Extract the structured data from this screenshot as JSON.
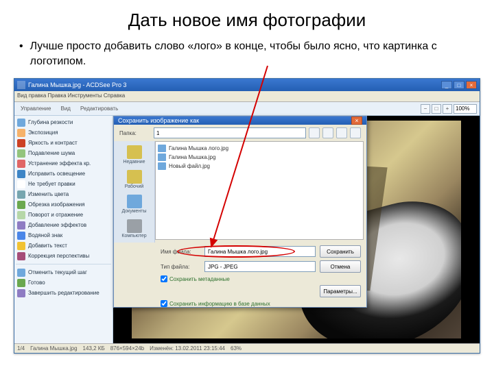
{
  "slide": {
    "title": "Дать новое имя фотографии",
    "bullet": "Лучше просто добавить слово «лого» в конце, чтобы было ясно, что картинка с логотипом."
  },
  "app": {
    "title": "Галина Мышка.jpg - ACDSee Pro 3",
    "menubar": "Вид правка Правка Инструменты Справка",
    "zoom_value": "100%",
    "toolbar": {
      "tab_browse": "Управление",
      "tab_view": "Вид",
      "tab_edit": "Редактировать"
    },
    "status": {
      "index": "1/4",
      "file": "Галина Мышка.jpg",
      "size": "143,2 КБ",
      "dims": "876×594×24b",
      "date": "Изменён: 13.02.2011 23:15:44",
      "pct": "63%"
    }
  },
  "sidebar": {
    "items": [
      {
        "label": "Глубина резкости",
        "color": "#6fa8dc"
      },
      {
        "label": "Экспозиция",
        "color": "#f6b26b"
      },
      {
        "label": "Яркость и контраст",
        "color": "#cc4125"
      },
      {
        "label": "Подавление шума",
        "color": "#93c47d"
      },
      {
        "label": "Устранение эффекта кр.",
        "color": "#e06666"
      },
      {
        "label": "Исправить освещение",
        "color": "#3d85c6"
      },
      {
        "label": "Не требует правки",
        "color": "#ffffff"
      },
      {
        "label": "Изменить цвета",
        "color": "#76a5af"
      },
      {
        "label": "Обрезка изображения",
        "color": "#6aa84f"
      },
      {
        "label": "Поворот и отражение",
        "color": "#b6d7a8"
      },
      {
        "label": "Добавление эффектов",
        "color": "#8e7cc3"
      },
      {
        "label": "Водяной знак",
        "color": "#4a86e8"
      },
      {
        "label": "Добавить текст",
        "color": "#f1c232"
      },
      {
        "label": "Коррекция перспективы",
        "color": "#a64d79"
      }
    ],
    "footer": [
      {
        "label": "Отменить текущий шаг",
        "color": "#6fa8dc"
      },
      {
        "label": "Готово",
        "color": "#6aa84f"
      },
      {
        "label": "Завершить редактирование",
        "color": "#8e7cc3"
      }
    ]
  },
  "dialog": {
    "title": "Сохранить изображение как",
    "folder_label": "Папка:",
    "folder_value": "1",
    "places": {
      "recent": "Недавние",
      "desktop": "Рабочий",
      "docs": "Документы",
      "comp": "Компьютер"
    },
    "files": [
      "Галина Мышка лого.jpg",
      "Галина Мышка.jpg",
      "Новый файл.jpg"
    ],
    "filename_label": "Имя файла:",
    "filename_value": "Галина Мышка лого.jpg",
    "filetype_label": "Тип файла:",
    "filetype_value": "JPG - JPEG",
    "btn_save": "Сохранить",
    "btn_cancel": "Отмена",
    "btn_options": "Параметры...",
    "chk_meta": "Сохранить метаданные",
    "chk_db": "Сохранить информацию в базе данных"
  }
}
